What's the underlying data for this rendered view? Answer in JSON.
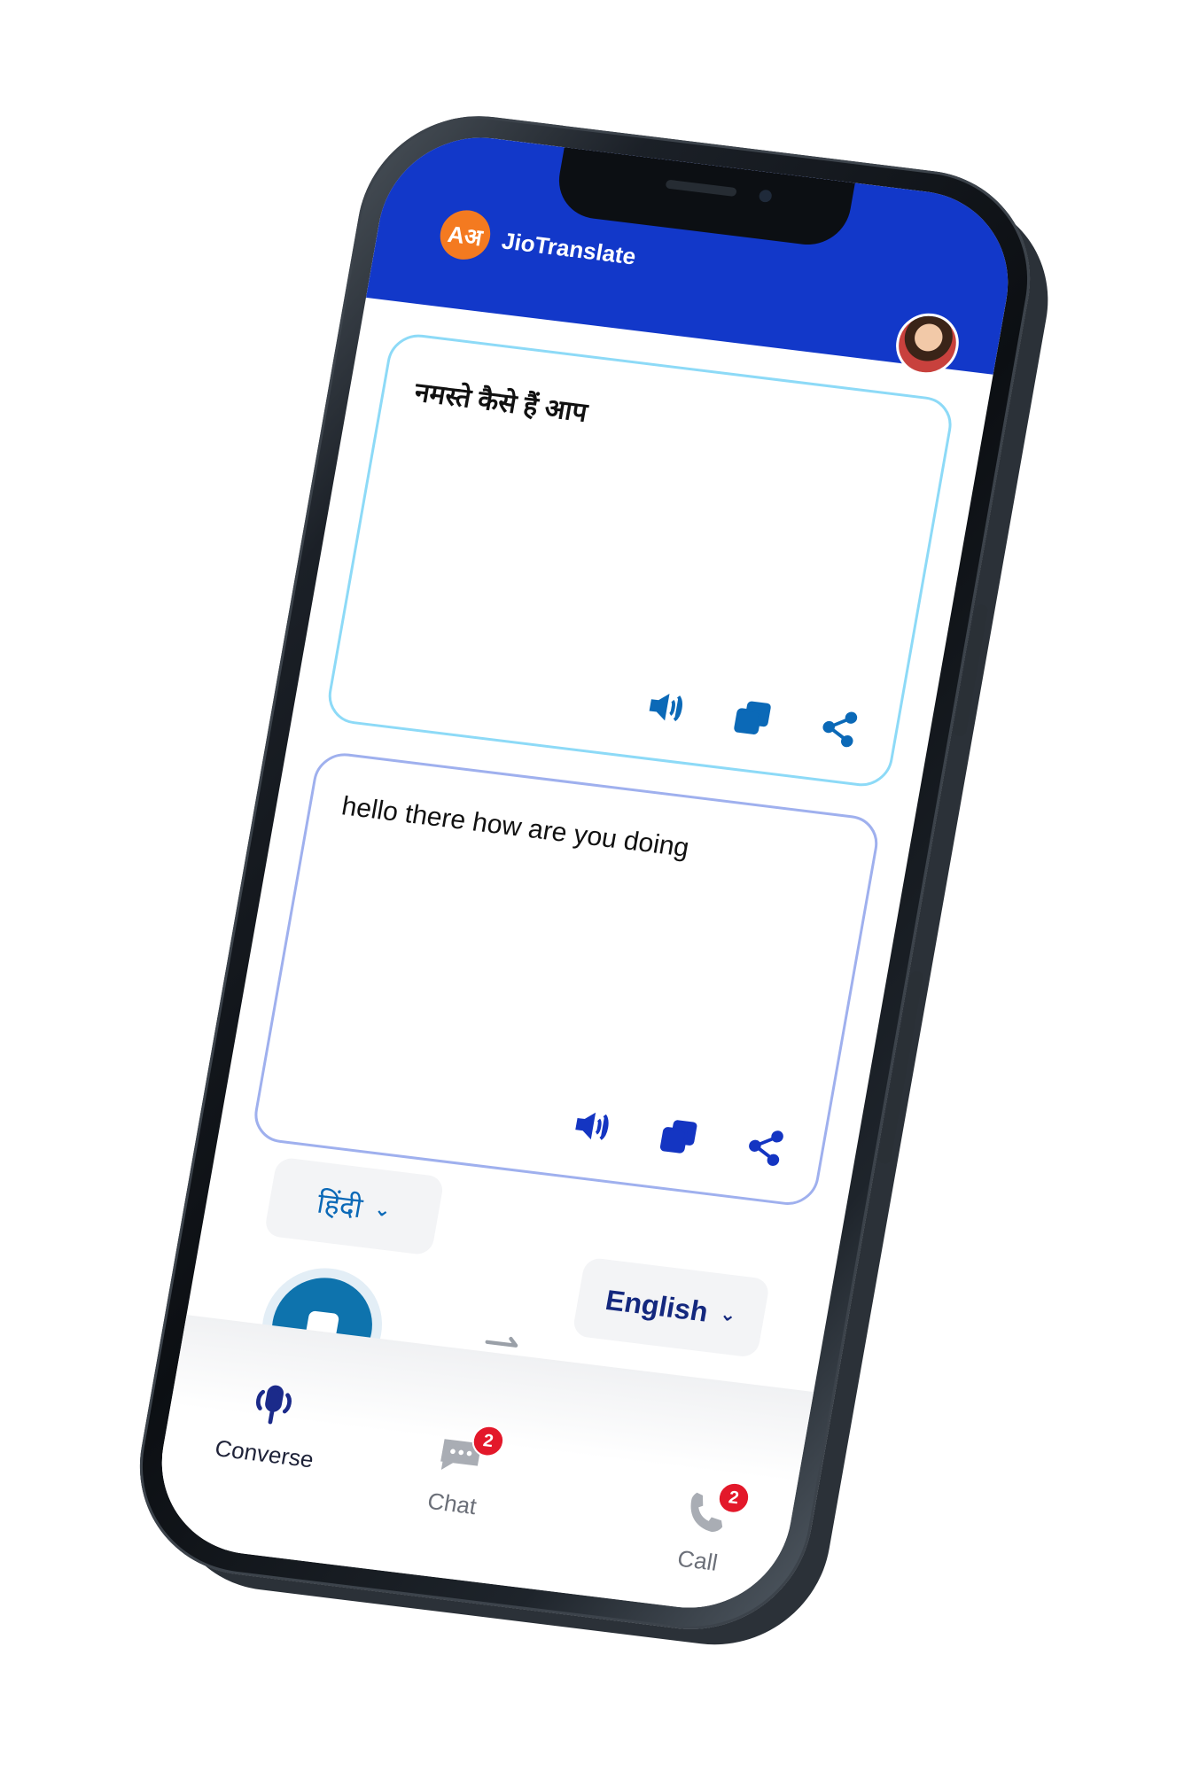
{
  "app": {
    "logo_text": "Aअ",
    "title": "JioTranslate"
  },
  "source_card": {
    "text": "नमस्ते कैसे हैं आप",
    "actions": [
      "speaker-icon",
      "copy-icon",
      "share-icon"
    ]
  },
  "target_card": {
    "text": "hello there how are you doing",
    "actions": [
      "speaker-icon",
      "copy-icon",
      "share-icon"
    ]
  },
  "languages": {
    "source": "हिंदी",
    "target": "English"
  },
  "nav": {
    "converse_label": "Converse",
    "chat_label": "Chat",
    "chat_badge": "2",
    "call_label": "Call",
    "call_badge": "2"
  },
  "colors": {
    "header": "#1238c9",
    "logo": "#f47a20",
    "source_accent": "#0b69b7",
    "target_accent": "#1435c2",
    "badge": "#e3182a"
  }
}
